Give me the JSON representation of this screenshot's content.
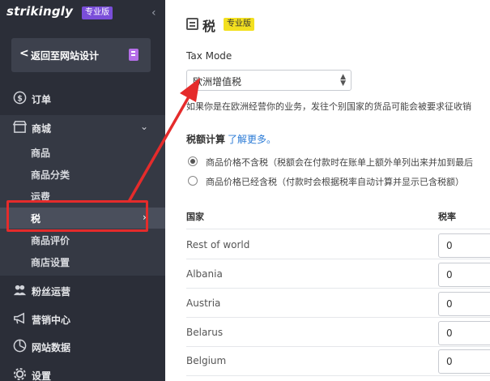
{
  "sidebar": {
    "logo": "strikingly",
    "pro_badge": "专业版",
    "back_label": "返回至网站设计",
    "nav_orders": "订单",
    "nav_store": "商城",
    "store_items": [
      "商品",
      "商品分类",
      "运费",
      "税",
      "商品评价",
      "商店设置"
    ],
    "nav_fans": "粉丝运营",
    "nav_marketing": "营销中心",
    "nav_analytics": "网站数据",
    "nav_settings": "设置"
  },
  "main": {
    "title": "税",
    "title_badge": "专业版",
    "tax_mode_label": "Tax Mode",
    "tax_mode_value": "欧洲增值税",
    "help_text": "如果你是在欧洲经营你的业务，发往个别国家的货品可能会被要求征收销",
    "calc_label": "税额计算",
    "learn_more": "了解更多。",
    "radio_exclusive": "商品价格不含税（税额会在付款时在账单上额外单列出来并加到最后",
    "radio_inclusive": "商品价格已经含税（付款时会根据税率自动计算并显示已含税额）",
    "col_country": "国家",
    "col_rate": "税率",
    "rows": [
      {
        "country": "Rest of world",
        "rate": "0"
      },
      {
        "country": "Albania",
        "rate": "0"
      },
      {
        "country": "Austria",
        "rate": "0"
      },
      {
        "country": "Belarus",
        "rate": "0"
      },
      {
        "country": "Belgium",
        "rate": "0"
      }
    ]
  },
  "colors": {
    "sidebar_bg": "#2b2e38",
    "annotation_red": "#e52b2b",
    "pro_badge": "#7a4ed9",
    "title_badge": "#f3e01f",
    "link": "#2b7bd6"
  }
}
